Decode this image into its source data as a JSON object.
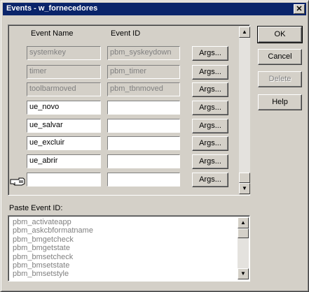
{
  "window": {
    "title": "Events - w_fornecedores"
  },
  "grid": {
    "col_event_name": "Event Name",
    "col_event_id": "Event ID",
    "args_label": "Args...",
    "rows": [
      {
        "name": "systemkey",
        "id": "pbm_syskeydown",
        "disabled": true
      },
      {
        "name": "timer",
        "id": "pbm_timer",
        "disabled": true
      },
      {
        "name": "toolbarmoved",
        "id": "pbm_tbnmoved",
        "disabled": true
      },
      {
        "name": "ue_novo",
        "id": "",
        "disabled": false
      },
      {
        "name": "ue_salvar",
        "id": "",
        "disabled": false
      },
      {
        "name": "ue_excluir",
        "id": "",
        "disabled": false
      },
      {
        "name": "ue_abrir",
        "id": "",
        "disabled": false
      },
      {
        "name": "",
        "id": "",
        "disabled": false
      }
    ]
  },
  "buttons": {
    "ok": "OK",
    "cancel": "Cancel",
    "delete": "Delete",
    "help": "Help"
  },
  "paste": {
    "label": "Paste Event ID:",
    "items": [
      "pbm_activateapp",
      "pbm_askcbformatname",
      "pbm_bmgetcheck",
      "pbm_bmgetstate",
      "pbm_bmsetcheck",
      "pbm_bmsetstate",
      "pbm_bmsetstyle"
    ]
  },
  "icons": {
    "close": "close-icon",
    "pointer": "hand-pointer-icon",
    "up": "arrow-up-icon",
    "down": "arrow-down-icon"
  },
  "colors": {
    "titlebar": "#0a246a",
    "face": "#d4d0c8",
    "disabled_text": "#808080"
  }
}
